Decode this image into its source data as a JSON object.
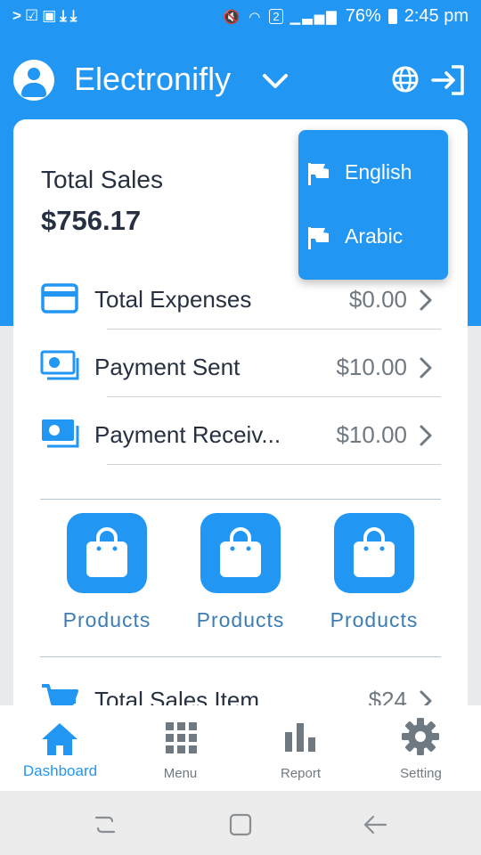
{
  "status_bar": {
    "left_icons": [
      "chevron-right-icon",
      "checkbox-icon",
      "image-icon",
      "download-icon",
      "download-icon"
    ],
    "right_icons": [
      "mute-icon",
      "wifi-icon",
      "sim-icon",
      "signal-icon",
      "battery-icon"
    ],
    "sim_badge": "2",
    "battery": "76%",
    "time": "2:45 pm"
  },
  "header": {
    "title": "Electronifly",
    "icons": [
      "user-avatar-icon",
      "chevron-down-icon",
      "globe-icon",
      "logout-icon"
    ]
  },
  "summary": {
    "total_sales_label": "Total Sales",
    "total_sales_value": "$756.17"
  },
  "rows": [
    {
      "label": "Total Expenses",
      "amount": "$0.00",
      "icon": "credit-card-icon"
    },
    {
      "label": "Payment Sent",
      "amount": "$10.00",
      "icon": "payment-icon"
    },
    {
      "label": "Payment Receiv...",
      "amount": "$10.00",
      "icon": "payment-icon"
    },
    {
      "label": "Total Sales Item",
      "amount": "$24",
      "icon": "cart-icon"
    }
  ],
  "products": [
    {
      "label": "Products",
      "icon": "shopping-bag-icon"
    },
    {
      "label": "Products",
      "icon": "shopping-bag-icon"
    },
    {
      "label": "Products",
      "icon": "shopping-bag-icon"
    }
  ],
  "language_menu": {
    "items": [
      {
        "label": "English",
        "icon": "flag-icon"
      },
      {
        "label": "Arabic",
        "icon": "flag-icon"
      }
    ]
  },
  "bottom_nav": {
    "items": [
      {
        "label": "Dashboard",
        "icon": "home-icon",
        "active": true
      },
      {
        "label": "Menu",
        "icon": "grid-icon",
        "active": false
      },
      {
        "label": "Report",
        "icon": "bar-chart-icon",
        "active": false
      },
      {
        "label": "Setting",
        "icon": "gear-icon",
        "active": false
      }
    ]
  },
  "system_nav": {
    "icons": [
      "recents-icon",
      "home-square-icon",
      "back-icon"
    ]
  },
  "colors": {
    "primary": "#2196f3",
    "text_dark": "#263040",
    "text_muted": "#6f7982",
    "product_label": "#3d7cb5",
    "background": "#e8ebee"
  }
}
